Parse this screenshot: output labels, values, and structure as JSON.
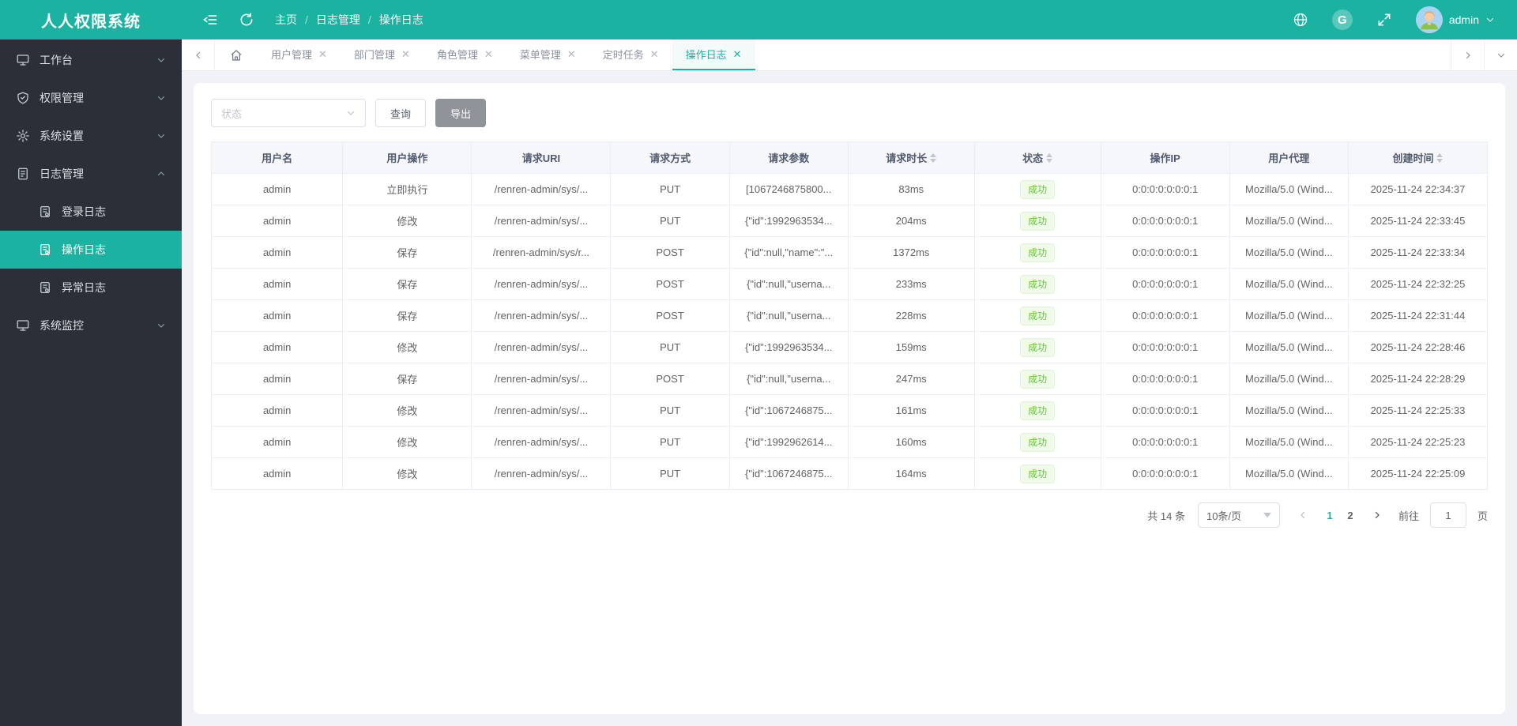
{
  "colors": {
    "accent": "#1cb2a2",
    "sidebar_bg": "#2a2f38",
    "success_text": "#67c23a",
    "success_bg": "#f0f9eb"
  },
  "brand": {
    "title": "人人权限系统"
  },
  "topbar": {
    "breadcrumb": [
      "主页",
      "日志管理",
      "操作日志"
    ],
    "username": "admin"
  },
  "sidebar": {
    "items": [
      {
        "label": "工作台",
        "icon": "monitor-icon"
      },
      {
        "label": "权限管理",
        "icon": "shield-icon"
      },
      {
        "label": "系统设置",
        "icon": "gear-icon"
      },
      {
        "label": "日志管理",
        "icon": "log-icon",
        "expanded": true,
        "children": [
          {
            "label": "登录日志",
            "icon": "doc-icon"
          },
          {
            "label": "操作日志",
            "icon": "doc-icon",
            "active": true
          },
          {
            "label": "异常日志",
            "icon": "doc-icon"
          }
        ]
      },
      {
        "label": "系统监控",
        "icon": "monitor-icon"
      }
    ]
  },
  "tabbar": {
    "tabs": [
      {
        "label": "用户管理"
      },
      {
        "label": "部门管理"
      },
      {
        "label": "角色管理"
      },
      {
        "label": "菜单管理"
      },
      {
        "label": "定时任务"
      },
      {
        "label": "操作日志",
        "active": true
      }
    ]
  },
  "filter": {
    "status_placeholder": "状态",
    "query_label": "查询",
    "export_label": "导出"
  },
  "table": {
    "columns": [
      {
        "label": "用户名"
      },
      {
        "label": "用户操作"
      },
      {
        "label": "请求URI"
      },
      {
        "label": "请求方式"
      },
      {
        "label": "请求参数"
      },
      {
        "label": "请求时长",
        "sortable": true
      },
      {
        "label": "状态",
        "sortable": true
      },
      {
        "label": "操作IP"
      },
      {
        "label": "用户代理"
      },
      {
        "label": "创建时间",
        "sortable": true
      }
    ],
    "rows": [
      {
        "cells": [
          "admin",
          "立即执行",
          "/renren-admin/sys/...",
          "PUT",
          "[1067246875800...",
          "83ms",
          "成功",
          "0:0:0:0:0:0:0:1",
          "Mozilla/5.0 (Wind...",
          "2025-11-24 22:34:37"
        ]
      },
      {
        "cells": [
          "admin",
          "修改",
          "/renren-admin/sys/...",
          "PUT",
          "{\"id\":1992963534...",
          "204ms",
          "成功",
          "0:0:0:0:0:0:0:1",
          "Mozilla/5.0 (Wind...",
          "2025-11-24 22:33:45"
        ]
      },
      {
        "cells": [
          "admin",
          "保存",
          "/renren-admin/sys/r...",
          "POST",
          "{\"id\":null,\"name\":\"...",
          "1372ms",
          "成功",
          "0:0:0:0:0:0:0:1",
          "Mozilla/5.0 (Wind...",
          "2025-11-24 22:33:34"
        ]
      },
      {
        "cells": [
          "admin",
          "保存",
          "/renren-admin/sys/...",
          "POST",
          "{\"id\":null,\"userna...",
          "233ms",
          "成功",
          "0:0:0:0:0:0:0:1",
          "Mozilla/5.0 (Wind...",
          "2025-11-24 22:32:25"
        ]
      },
      {
        "cells": [
          "admin",
          "保存",
          "/renren-admin/sys/...",
          "POST",
          "{\"id\":null,\"userna...",
          "228ms",
          "成功",
          "0:0:0:0:0:0:0:1",
          "Mozilla/5.0 (Wind...",
          "2025-11-24 22:31:44"
        ]
      },
      {
        "cells": [
          "admin",
          "修改",
          "/renren-admin/sys/...",
          "PUT",
          "{\"id\":1992963534...",
          "159ms",
          "成功",
          "0:0:0:0:0:0:0:1",
          "Mozilla/5.0 (Wind...",
          "2025-11-24 22:28:46"
        ]
      },
      {
        "cells": [
          "admin",
          "保存",
          "/renren-admin/sys/...",
          "POST",
          "{\"id\":null,\"userna...",
          "247ms",
          "成功",
          "0:0:0:0:0:0:0:1",
          "Mozilla/5.0 (Wind...",
          "2025-11-24 22:28:29"
        ]
      },
      {
        "cells": [
          "admin",
          "修改",
          "/renren-admin/sys/...",
          "PUT",
          "{\"id\":1067246875...",
          "161ms",
          "成功",
          "0:0:0:0:0:0:0:1",
          "Mozilla/5.0 (Wind...",
          "2025-11-24 22:25:33"
        ]
      },
      {
        "cells": [
          "admin",
          "修改",
          "/renren-admin/sys/...",
          "PUT",
          "{\"id\":1992962614...",
          "160ms",
          "成功",
          "0:0:0:0:0:0:0:1",
          "Mozilla/5.0 (Wind...",
          "2025-11-24 22:25:23"
        ]
      },
      {
        "cells": [
          "admin",
          "修改",
          "/renren-admin/sys/...",
          "PUT",
          "{\"id\":1067246875...",
          "164ms",
          "成功",
          "0:0:0:0:0:0:0:1",
          "Mozilla/5.0 (Wind...",
          "2025-11-24 22:25:09"
        ]
      }
    ]
  },
  "pagination": {
    "total": "共 14 条",
    "page_size": "10条/页",
    "pages": [
      "1",
      "2"
    ],
    "active_page": "1",
    "goto_label": "前往",
    "goto_value": "1",
    "unit_label": "页"
  }
}
